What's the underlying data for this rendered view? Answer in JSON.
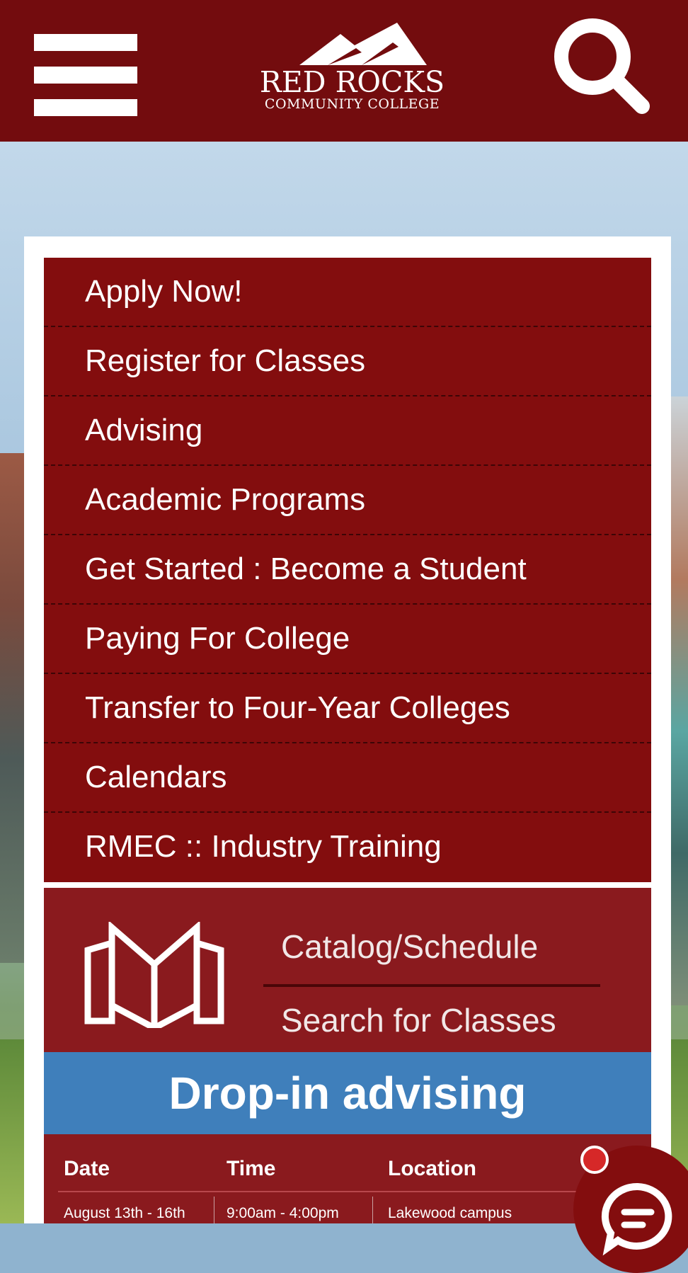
{
  "header": {
    "logo_name": "RED ROCKS",
    "logo_sub": "COMMUNITY COLLEGE",
    "menu_icon": "hamburger-menu-icon",
    "search_icon": "magnifier-search-icon"
  },
  "nav": {
    "items": [
      {
        "label": "Apply Now!"
      },
      {
        "label": "Register for Classes"
      },
      {
        "label": "Advising"
      },
      {
        "label": "Academic Programs"
      },
      {
        "label": "Get Started : Become a Student"
      },
      {
        "label": "Paying For College"
      },
      {
        "label": "Transfer to Four-Year Colleges"
      },
      {
        "label": "Calendars"
      },
      {
        "label": "RMEC :: Industry Training"
      }
    ]
  },
  "catalog": {
    "line1": "Catalog/Schedule",
    "line2": "Search for Classes",
    "icon": "open-book-icon"
  },
  "dropin": {
    "title": "Drop-in advising"
  },
  "schedule": {
    "headers": [
      "Date",
      "Time",
      "Location"
    ],
    "rows": [
      [
        "August 13th - 16th",
        "9:00am - 4:00pm",
        "Lakewood campus"
      ]
    ]
  },
  "chat": {
    "icon": "chat-bubble-icon"
  },
  "colors": {
    "header": "#730c0e",
    "nav": "#830d0e",
    "banner_blue": "#3f7fbb",
    "accent_red": "#d62828"
  }
}
